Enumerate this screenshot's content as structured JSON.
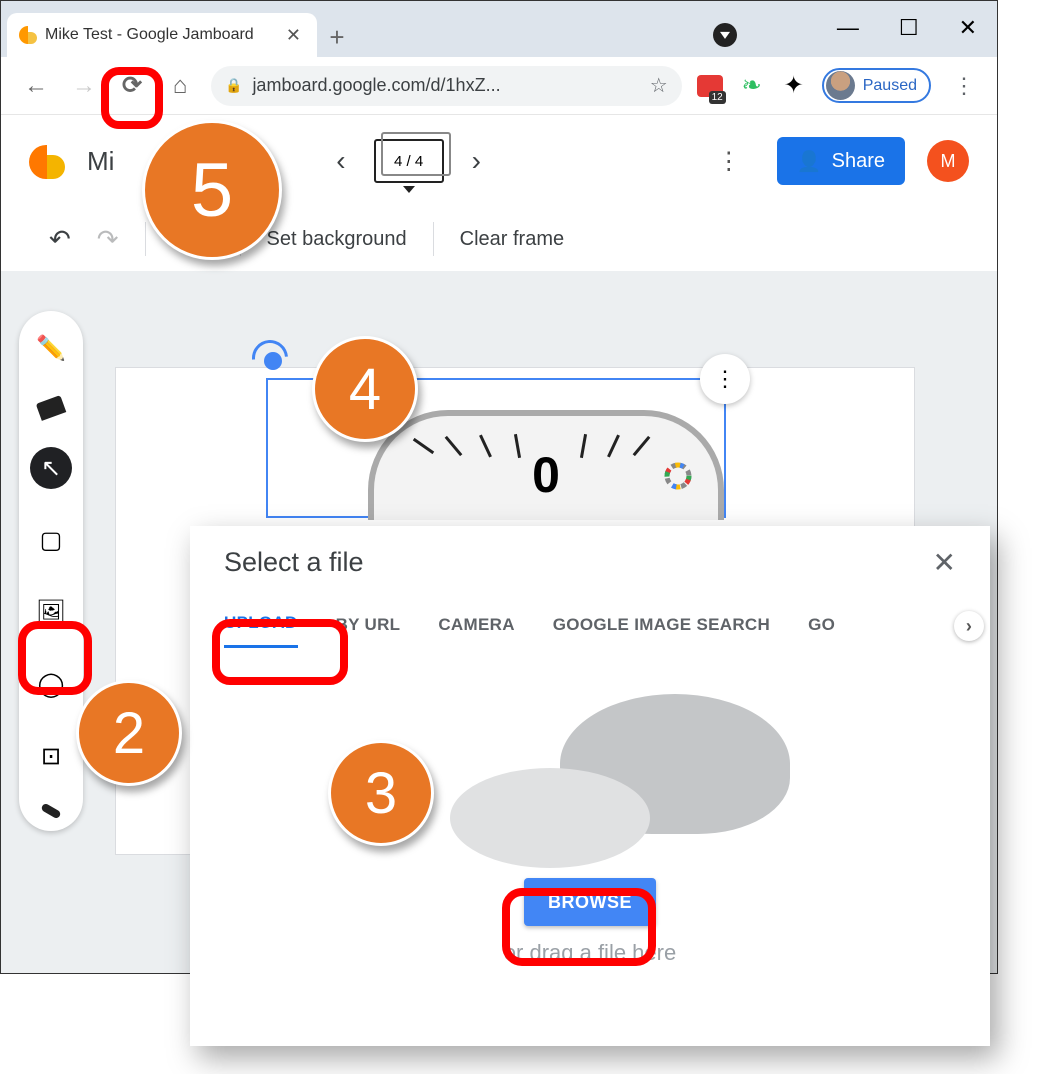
{
  "browser": {
    "tab_title": "Mike Test - Google Jamboard",
    "url_display": "jamboard.google.com/d/1hxZ...",
    "profile_state": "Paused",
    "extensions": {
      "ext1_badge": "12"
    }
  },
  "app": {
    "doc_title_visible": "Mi",
    "frame_indicator": "4 / 4",
    "share_label": "Share",
    "user_initial": "M",
    "toolbar": {
      "set_bg": "Set background",
      "clear": "Clear frame"
    }
  },
  "canvas": {
    "image_zero": "0"
  },
  "dialog": {
    "title": "Select a file",
    "tabs": {
      "upload": "UPLOAD",
      "by_url": "BY URL",
      "camera": "CAMERA",
      "gimg": "GOOGLE IMAGE SEARCH",
      "gdrive_cut": "GO"
    },
    "browse": "BROWSE",
    "drag_text": "or drag a file here"
  },
  "callouts": {
    "c2": "2",
    "c3": "3",
    "c4": "4",
    "c5": "5"
  }
}
